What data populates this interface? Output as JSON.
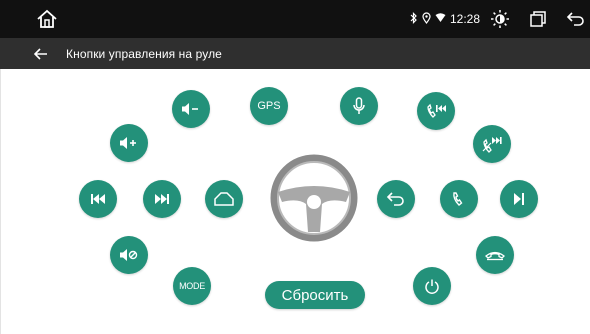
{
  "status_bar": {
    "time": "12:28",
    "icons": [
      "home-icon",
      "bluetooth-icon",
      "location-icon",
      "wifi-icon",
      "brightness-icon",
      "recent-apps-icon",
      "back-icon"
    ]
  },
  "header": {
    "title": "Кнопки управления на руле"
  },
  "buttons": {
    "gps": "GPS",
    "mode": "MODE"
  },
  "reset_label": "Сбросить",
  "colors": {
    "accent": "#23917a",
    "statusbar": "#111111",
    "titlebar": "#2f2f2f"
  }
}
